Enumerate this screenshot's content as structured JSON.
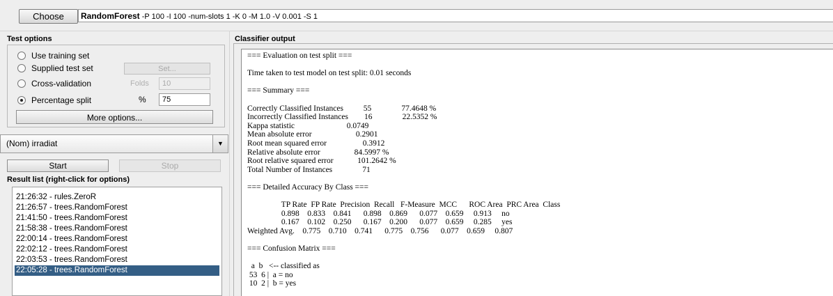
{
  "toolbar": {
    "choose_label": "Choose",
    "classifier_name": "RandomForest",
    "classifier_options": " -P 100 -I 100 -num-slots 1 -K 0 -M 1.0 -V 0.001 -S 1"
  },
  "test_options": {
    "title": "Test options",
    "use_training_set": "Use training set",
    "supplied_test_set": "Supplied test set",
    "set_button": "Set...",
    "cross_validation": "Cross-validation",
    "folds_label": "Folds",
    "folds_value": "10",
    "percentage_split": "Percentage split",
    "percent_symbol": "%",
    "percent_value": "75",
    "selected_option": "Percentage split",
    "more_options": "More options..."
  },
  "class_attribute": {
    "selected": "(Nom) irradiat"
  },
  "run_controls": {
    "start": "Start",
    "stop": "Stop"
  },
  "result_list": {
    "title": "Result list (right-click for options)",
    "items": [
      "21:26:32 - rules.ZeroR",
      "21:26:57 - trees.RandomForest",
      "21:41:50 - trees.RandomForest",
      "21:58:38 - trees.RandomForest",
      "22:00:14 - trees.RandomForest",
      "22:02:12 - trees.RandomForest",
      "22:03:53 - trees.RandomForest",
      "22:05:28 - trees.RandomForest"
    ],
    "selected_index": 7
  },
  "classifier_output": {
    "title": "Classifier output",
    "lines": [
      "=== Evaluation on test split ===",
      "",
      "Time taken to test model on test split: 0.01 seconds",
      "",
      "=== Summary ===",
      "",
      "Correctly Classified Instances          55               77.4648 %",
      "Incorrectly Classified Instances        16               22.5352 %",
      "Kappa statistic                          0.0749",
      "Mean absolute error                      0.2901",
      "Root mean squared error                  0.3912",
      "Relative absolute error                 84.5997 %",
      "Root relative squared error            101.2642 %",
      "Total Number of Instances               71",
      "",
      "=== Detailed Accuracy By Class ===",
      "",
      "                 TP Rate  FP Rate  Precision  Recall   F-Measure  MCC      ROC Area  PRC Area  Class",
      "                 0.898    0.833    0.841      0.898    0.869      0.077    0.659     0.913     no",
      "                 0.167    0.102    0.250      0.167    0.200      0.077    0.659     0.285     yes",
      "Weighted Avg.    0.775    0.710    0.741      0.775    0.756      0.077    0.659     0.807",
      "",
      "=== Confusion Matrix ===",
      "",
      "  a  b   <-- classified as",
      " 53  6 |  a = no",
      " 10  2 |  b = yes"
    ]
  },
  "colors": {
    "selection": "#345e85",
    "panel_bg": "#eeeeee"
  }
}
